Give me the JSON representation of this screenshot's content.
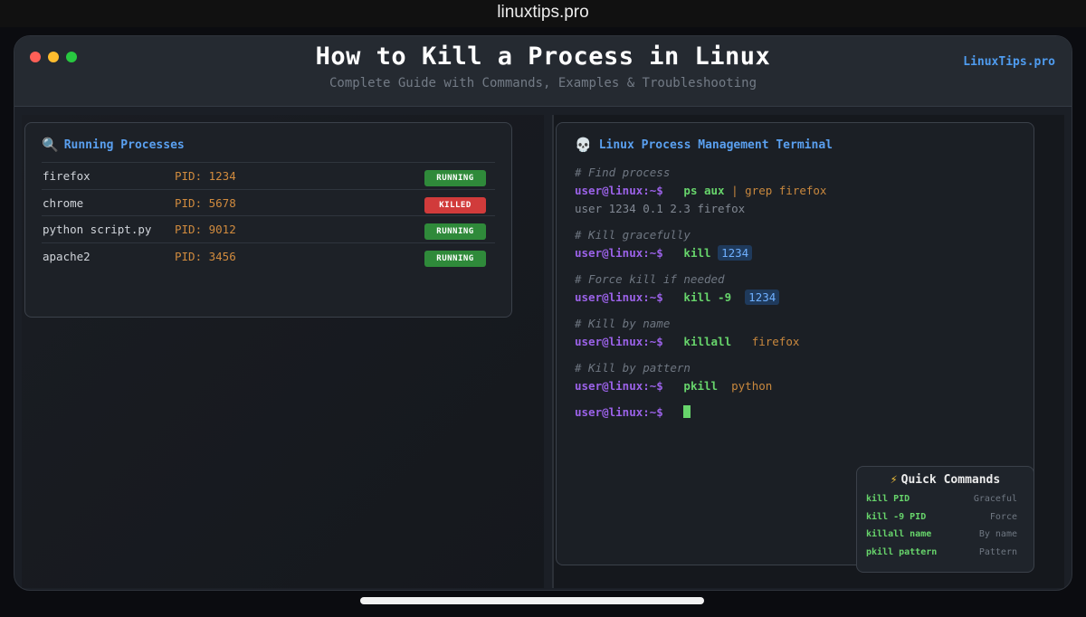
{
  "browser": {
    "url": "linuxtips.pro"
  },
  "header": {
    "title": "How to Kill a Process in Linux",
    "subtitle": "Complete Guide with Commands, Examples & Troubleshooting",
    "brand": "LinuxTips.pro"
  },
  "processes": {
    "title": "Running Processes",
    "icon": "magnifier-icon",
    "items": [
      {
        "name": "firefox",
        "pid": "PID: 1234",
        "status": "RUNNING"
      },
      {
        "name": "chrome",
        "pid": "PID: 5678",
        "status": "KILLED"
      },
      {
        "name": "python script.py",
        "pid": "PID: 9012",
        "status": "RUNNING"
      },
      {
        "name": "apache2",
        "pid": "PID: 3456",
        "status": "RUNNING"
      }
    ]
  },
  "terminal": {
    "title": "Linux Process Management Terminal",
    "icon": "skull-icon",
    "prompt": "user@linux:~$",
    "blocks": [
      {
        "comment": "# Find process",
        "cmd": "ps aux",
        "rest": " | grep firefox",
        "output": "user 1234 0.1 2.3 firefox"
      },
      {
        "comment": "# Kill gracefully",
        "cmd": "kill",
        "pid": "1234"
      },
      {
        "comment": "# Force kill if needed",
        "cmd": "kill -9",
        "pid": "1234"
      },
      {
        "comment": "# Kill by name",
        "cmd": "killall",
        "arg": "firefox"
      },
      {
        "comment": "# Kill by pattern",
        "cmd": "pkill",
        "arg": "python"
      }
    ]
  },
  "quick": {
    "title": "Quick Commands",
    "items": [
      {
        "cmd": "kill PID",
        "desc": "Graceful"
      },
      {
        "cmd": "kill -9 PID",
        "desc": "Force"
      },
      {
        "cmd": "killall name",
        "desc": "By name"
      },
      {
        "cmd": "pkill pattern",
        "desc": "Pattern"
      }
    ]
  },
  "colors": {
    "running": "#2f8a3a",
    "killed": "#d13b3b",
    "prompt": "#9b62e8",
    "command": "#67d46b",
    "accent": "#5aa0f0"
  }
}
